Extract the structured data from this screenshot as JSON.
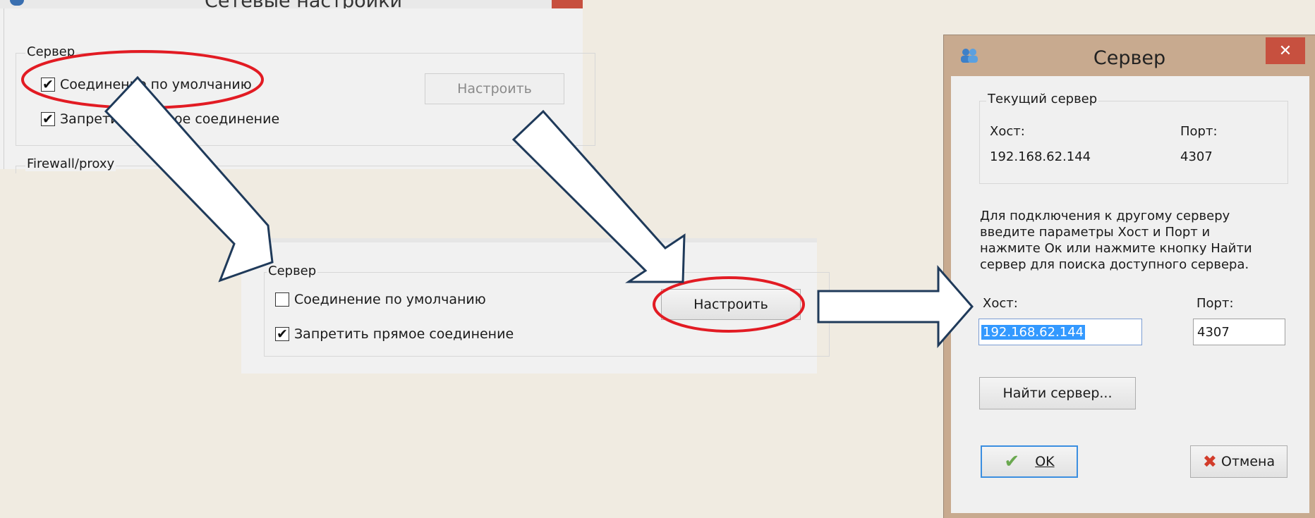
{
  "panel1": {
    "title": "Сетевые настройки",
    "group_server": "Сервер",
    "default_connection": "Соединение по умолчанию",
    "default_connection_checked": true,
    "forbid_direct": "Запретить прямое соединение",
    "forbid_direct_checked": true,
    "configure_button": "Настроить",
    "group_firewall": "Firewall/proxy"
  },
  "panel2": {
    "group_server": "Сервер",
    "default_connection": "Соединение по умолчанию",
    "default_connection_checked": false,
    "forbid_direct": "Запретить прямое соединение",
    "forbid_direct_checked": true,
    "configure_button": "Настроить"
  },
  "dialog": {
    "title": "Сервер",
    "close_glyph": "✕",
    "current_group": "Текущий сервер",
    "host_label": "Хост:",
    "port_label": "Порт:",
    "current_host": "192.168.62.144",
    "current_port": "4307",
    "instructions_1": "Для подключения к другому серверу",
    "instructions_2": "введите параметры Хост и Порт и",
    "instructions_3": "нажмите Ок или нажмите кнопку Найти",
    "instructions_4": "сервер для поиска доступного сервера.",
    "host_field_label": "Хост:",
    "port_field_label": "Порт:",
    "host_value": "192.168.62.144",
    "port_value": "4307",
    "find_button": "Найти сервер...",
    "ok_button": "OK",
    "cancel_button": "Отмена"
  },
  "colors": {
    "background": "#f0ebe1",
    "highlight_red": "#e21b23",
    "dialog_frame": "#c8aa8f",
    "close_button": "#c7503f",
    "selection_blue": "#3399ff"
  }
}
